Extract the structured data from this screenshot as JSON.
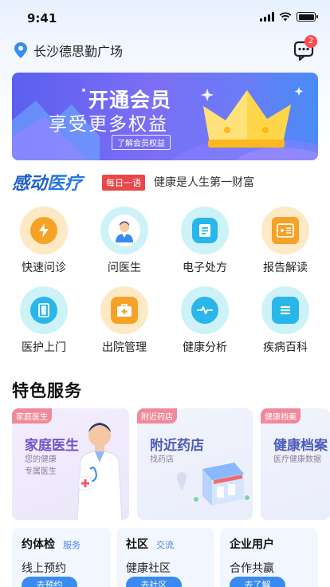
{
  "status": {
    "time": "9:41"
  },
  "header": {
    "location": "长沙德思勤广场",
    "message_count": "2"
  },
  "banner": {
    "title": "开通会员",
    "subtitle": "享受更多权益",
    "link_label": "了解会员权益"
  },
  "slogan": {
    "brand_a": "感动",
    "brand_b": "医疗",
    "tag": "每日一语",
    "text": "健康是人生第一财富"
  },
  "services": [
    {
      "label": "快速问诊",
      "icon": "lightning-icon",
      "outer": "#fde9c5",
      "inner": "#f6a226"
    },
    {
      "label": "问医生",
      "icon": "doctor-avatar-icon",
      "outer": "#cdf2f7",
      "inner": "#ffffff"
    },
    {
      "label": "电子处方",
      "icon": "prescription-icon",
      "outer": "#cdf2f7",
      "inner": "#29b6ea"
    },
    {
      "label": "报告解读",
      "icon": "report-icon",
      "outer": "#fde9c5",
      "inner": "#f6a226"
    },
    {
      "label": "医护上门",
      "icon": "door-icon",
      "outer": "#cdf2f7",
      "inner": "#29b6ea"
    },
    {
      "label": "出院管理",
      "icon": "medical-kit-icon",
      "outer": "#fde9c5",
      "inner": "#f6a226"
    },
    {
      "label": "健康分析",
      "icon": "pulse-icon",
      "outer": "#cdf2f7",
      "inner": "#29b6ea"
    },
    {
      "label": "疾病百科",
      "icon": "encyclopedia-icon",
      "outer": "#cdf2f7",
      "inner": "#29b6ea"
    }
  ],
  "featured": {
    "title": "特色服务",
    "cards": [
      {
        "tag": "家庭医生",
        "title": "家庭医生",
        "desc_1": "您的健康",
        "desc_2": "专属医生"
      },
      {
        "tag": "附近药店",
        "title": "附近药店",
        "desc_1": "找药店",
        "desc_2": ""
      },
      {
        "tag": "健康档案",
        "title": "健康档案",
        "desc_1": "医疗健康数据",
        "desc_2": ""
      }
    ]
  },
  "bottom_cards": [
    {
      "title": "约体检",
      "tag": "服务",
      "sub": "线上预约",
      "button": "去预约"
    },
    {
      "title": "社区",
      "tag": "交流",
      "sub": "健康社区",
      "button": "去社区"
    },
    {
      "title": "企业用户",
      "tag": "",
      "sub": "合作共赢",
      "button": "去了解"
    }
  ],
  "colors": {
    "primary": "#3a8bf0",
    "brand": "#1f5fc9",
    "badge": "#ff4d4f",
    "tag_red": "#e84848"
  }
}
